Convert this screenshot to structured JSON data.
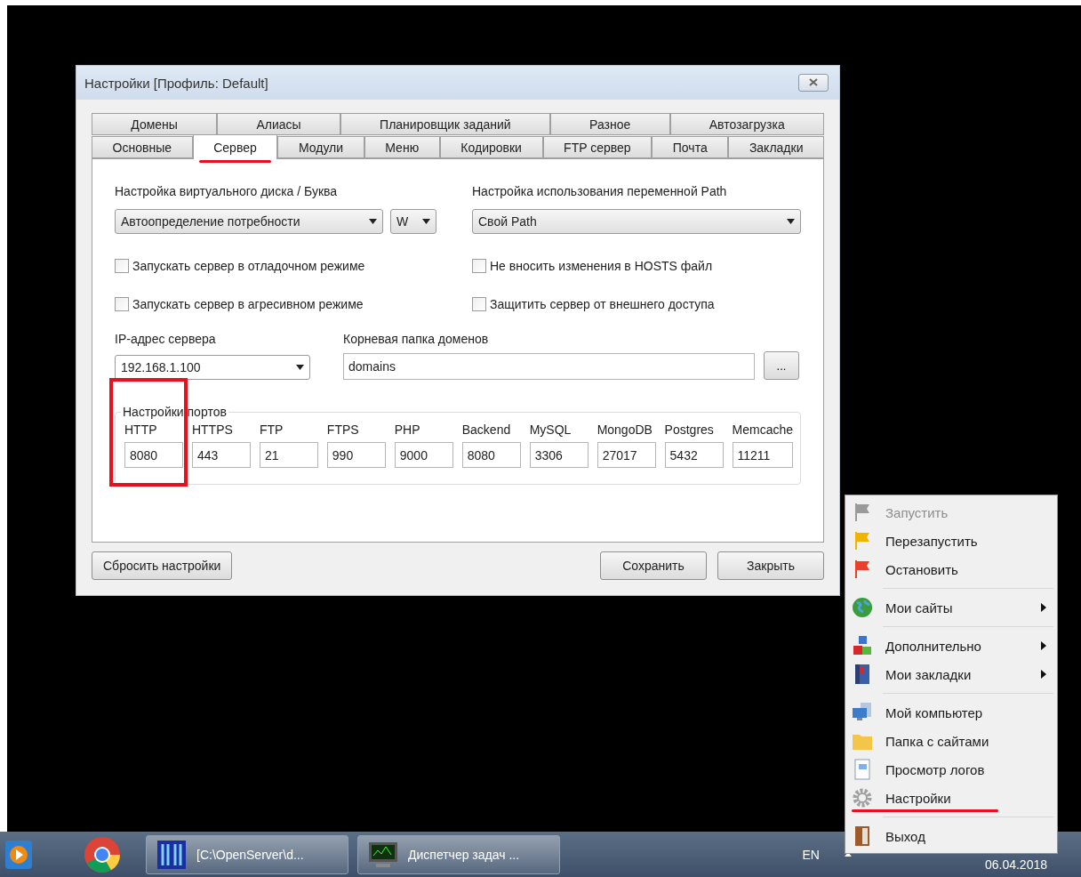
{
  "dialog": {
    "title": "Настройки [Профиль: Default]",
    "tab_rows": [
      [
        {
          "label": "Домены",
          "selected": false,
          "highlighted": false
        },
        {
          "label": "Алиасы",
          "selected": false,
          "highlighted": false
        },
        {
          "label": "Планировщик заданий",
          "selected": false,
          "highlighted": false
        },
        {
          "label": "Разное",
          "selected": false,
          "highlighted": false
        },
        {
          "label": "Автозагрузка",
          "selected": false,
          "highlighted": false
        }
      ],
      [
        {
          "label": "Основные",
          "selected": false,
          "highlighted": false
        },
        {
          "label": "Сервер",
          "selected": true,
          "highlighted": true
        },
        {
          "label": "Модули",
          "selected": false,
          "highlighted": false
        },
        {
          "label": "Меню",
          "selected": false,
          "highlighted": false
        },
        {
          "label": "Кодировки",
          "selected": false,
          "highlighted": false
        },
        {
          "label": "FTP сервер",
          "selected": false,
          "highlighted": false
        },
        {
          "label": "Почта",
          "selected": false,
          "highlighted": false
        },
        {
          "label": "Закладки",
          "selected": false,
          "highlighted": false
        }
      ]
    ],
    "disk_label": "Настройка виртуального диска / Буква",
    "disk_mode": "Автоопределение потребности",
    "disk_letter": "W",
    "path_label": "Настройка использования переменной Path",
    "path_mode": "Свой Path",
    "checkboxes": [
      {
        "label": "Запускать сервер в отладочном режиме",
        "checked": false
      },
      {
        "label": "Не вносить изменения в HOSTS файл",
        "checked": false
      },
      {
        "label": "Запускать сервер в агресивном режиме",
        "checked": false
      },
      {
        "label": "Защитить сервер от внешнего доступа",
        "checked": false
      }
    ],
    "ip_label": "IP-адрес сервера",
    "ip_value": "192.168.1.100",
    "root_label": "Корневая папка доменов",
    "root_value": "domains",
    "browse": "...",
    "ports_title": "Настройки портов",
    "ports": [
      {
        "name": "HTTP",
        "value": "8080",
        "highlighted": true
      },
      {
        "name": "HTTPS",
        "value": "443",
        "highlighted": false
      },
      {
        "name": "FTP",
        "value": "21",
        "highlighted": false
      },
      {
        "name": "FTPS",
        "value": "990",
        "highlighted": false
      },
      {
        "name": "PHP",
        "value": "9000",
        "highlighted": false
      },
      {
        "name": "Backend",
        "value": "8080",
        "highlighted": false
      },
      {
        "name": "MySQL",
        "value": "3306",
        "highlighted": false
      },
      {
        "name": "MongoDB",
        "value": "27017",
        "highlighted": false
      },
      {
        "name": "Postgres",
        "value": "5432",
        "highlighted": false
      },
      {
        "name": "Memcache",
        "value": "11211",
        "highlighted": false
      }
    ],
    "buttons": {
      "reset": "Сбросить настройки",
      "save": "Сохранить",
      "close": "Закрыть"
    }
  },
  "menu": {
    "groups": [
      [
        {
          "label": "Запустить",
          "kind": "flag-grey",
          "disabled": true,
          "submenu": false,
          "highlighted": false
        },
        {
          "label": "Перезапустить",
          "kind": "flag-yellow",
          "disabled": false,
          "submenu": false,
          "highlighted": false
        },
        {
          "label": "Остановить",
          "kind": "flag-red",
          "disabled": false,
          "submenu": false,
          "highlighted": false
        }
      ],
      [
        {
          "label": "Мои сайты",
          "kind": "globe",
          "disabled": false,
          "submenu": true,
          "highlighted": false
        }
      ],
      [
        {
          "label": "Дополнительно",
          "kind": "blocks",
          "disabled": false,
          "submenu": true,
          "highlighted": false
        },
        {
          "label": "Мои закладки",
          "kind": "book",
          "disabled": false,
          "submenu": true,
          "highlighted": false
        }
      ],
      [
        {
          "label": "Мой компьютер",
          "kind": "computer",
          "disabled": false,
          "submenu": false,
          "highlighted": false
        },
        {
          "label": "Папка с сайтами",
          "kind": "folder",
          "disabled": false,
          "submenu": false,
          "highlighted": false
        },
        {
          "label": "Просмотр логов",
          "kind": "log",
          "disabled": false,
          "submenu": false,
          "highlighted": false
        },
        {
          "label": "Настройки",
          "kind": "gear",
          "disabled": false,
          "submenu": false,
          "highlighted": true
        }
      ],
      [
        {
          "label": "Выход",
          "kind": "door",
          "disabled": false,
          "submenu": false,
          "highlighted": false
        }
      ]
    ]
  },
  "taskbar": {
    "tasks": [
      {
        "label": "[C:\\OpenServer\\d...",
        "kind": "server"
      },
      {
        "label": "Диспетчер задач ...",
        "kind": "monitor"
      }
    ],
    "language": "EN",
    "date": "06.04.2018"
  }
}
